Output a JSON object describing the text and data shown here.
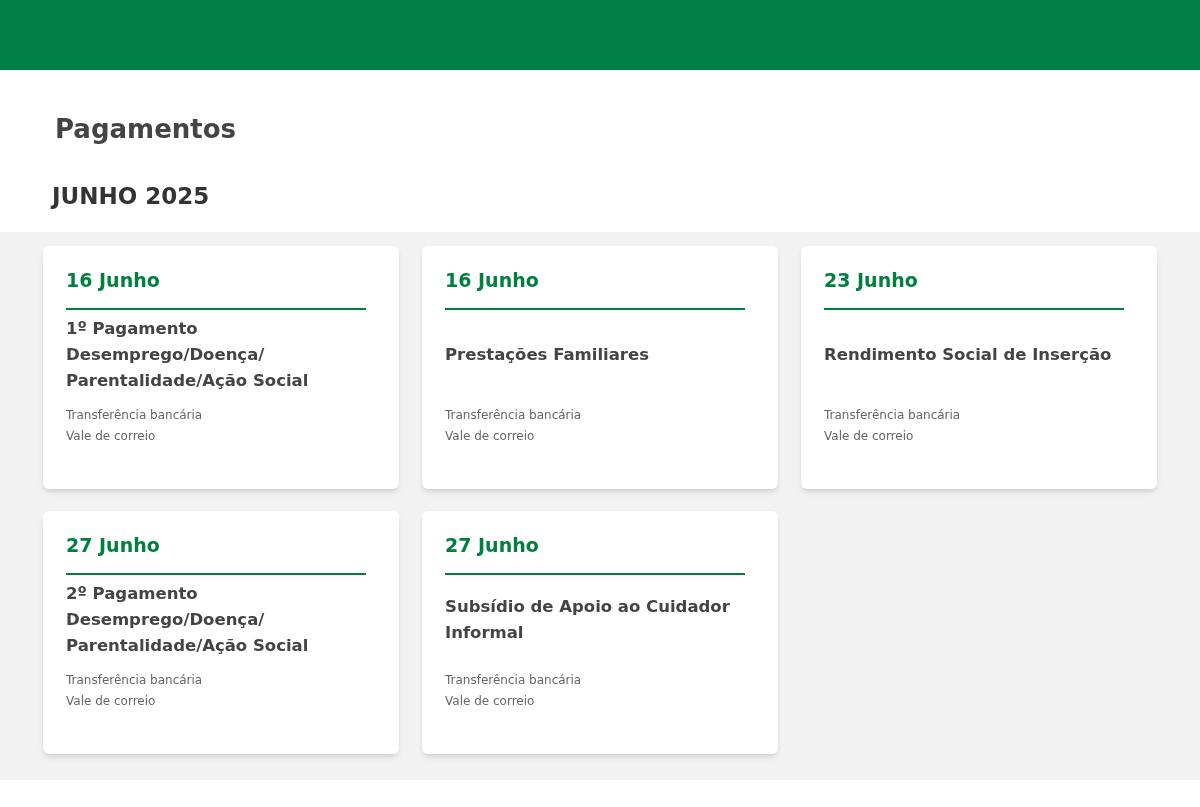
{
  "page": {
    "title": "Pagamentos"
  },
  "month": "JUNHO 2025",
  "payments": [
    {
      "date": "16 Junho",
      "title": "1º Pagamento Desemprego/Doença/ Parentalidade/Ação Social",
      "methods": [
        "Transferência bancária",
        "Vale de correio"
      ]
    },
    {
      "date": "16 Junho",
      "title": "Prestações Familiares",
      "methods": [
        "Transferência bancária",
        "Vale de correio"
      ]
    },
    {
      "date": "23 Junho",
      "title": "Rendimento Social de Inserção",
      "methods": [
        "Transferência bancária",
        "Vale de correio"
      ]
    },
    {
      "date": "27 Junho",
      "title": "2º Pagamento Desemprego/Doença/ Parentalidade/Ação Social",
      "methods": [
        "Transferência bancária",
        "Vale de correio"
      ]
    },
    {
      "date": "27 Junho",
      "title": "Subsídio de Apoio ao Cuidador Informal",
      "methods": [
        "Transferência bancária",
        "Vale de correio"
      ]
    }
  ]
}
